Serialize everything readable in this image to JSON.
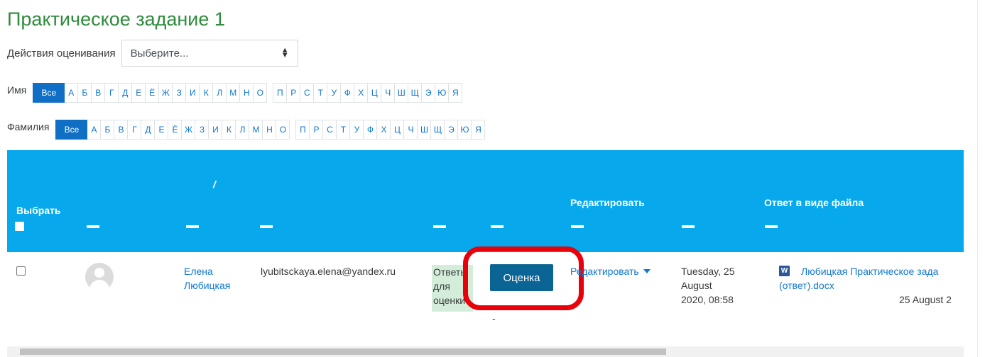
{
  "page": {
    "title": "Практическое задание 1"
  },
  "grading": {
    "label": "Действия оценивания",
    "select_value": "Выберите..."
  },
  "first_name_filter": {
    "label": "Имя",
    "all": "Все",
    "letters": [
      "А",
      "Б",
      "В",
      "Г",
      "Д",
      "Е",
      "Ё",
      "Ж",
      "З",
      "И",
      "К",
      "Л",
      "М",
      "Н",
      "О",
      "П",
      "Р",
      "С",
      "Т",
      "У",
      "Ф",
      "Х",
      "Ц",
      "Ч",
      "Ш",
      "Щ",
      "Э",
      "Ю",
      "Я"
    ]
  },
  "last_name_filter": {
    "label": "Фамилия",
    "all": "Все",
    "letters": [
      "А",
      "Б",
      "В",
      "Г",
      "Д",
      "Е",
      "Ё",
      "Ж",
      "З",
      "И",
      "К",
      "Л",
      "М",
      "Н",
      "О",
      "П",
      "Р",
      "С",
      "Т",
      "У",
      "Ф",
      "Х",
      "Ц",
      "Ч",
      "Ш",
      "Щ",
      "Э",
      "Ю",
      "Я"
    ]
  },
  "table": {
    "headers": {
      "select": "Выбрать",
      "name_slash": "/",
      "edit": "Редактировать",
      "file_answer": "Ответ в виде файла"
    },
    "row": {
      "first_name": "Елена",
      "last_name": "Любицкая",
      "email": "lyubitsckaya.elena@yandex.ru",
      "status_lines": [
        "Ответы",
        "для",
        "оценки"
      ],
      "grade_button": "Оценка",
      "grade_dash": "-",
      "edit_link": "Редактировать",
      "modified_lines": [
        "Tuesday, 25",
        "August",
        "2020, 08:58"
      ],
      "file_name_line1": "Любицкая Практическое зада",
      "file_name_line2": "(ответ).docx",
      "file_date": "25 August 2",
      "file_icon": "W"
    }
  },
  "colors": {
    "title": "#2e8b3c",
    "header_bg": "#08a8ec",
    "link": "#1177d1",
    "active_pager": "#0f6fc5",
    "grade_button": "#0a6494",
    "status_bg": "#d4edda",
    "highlight": "#e8000a"
  }
}
